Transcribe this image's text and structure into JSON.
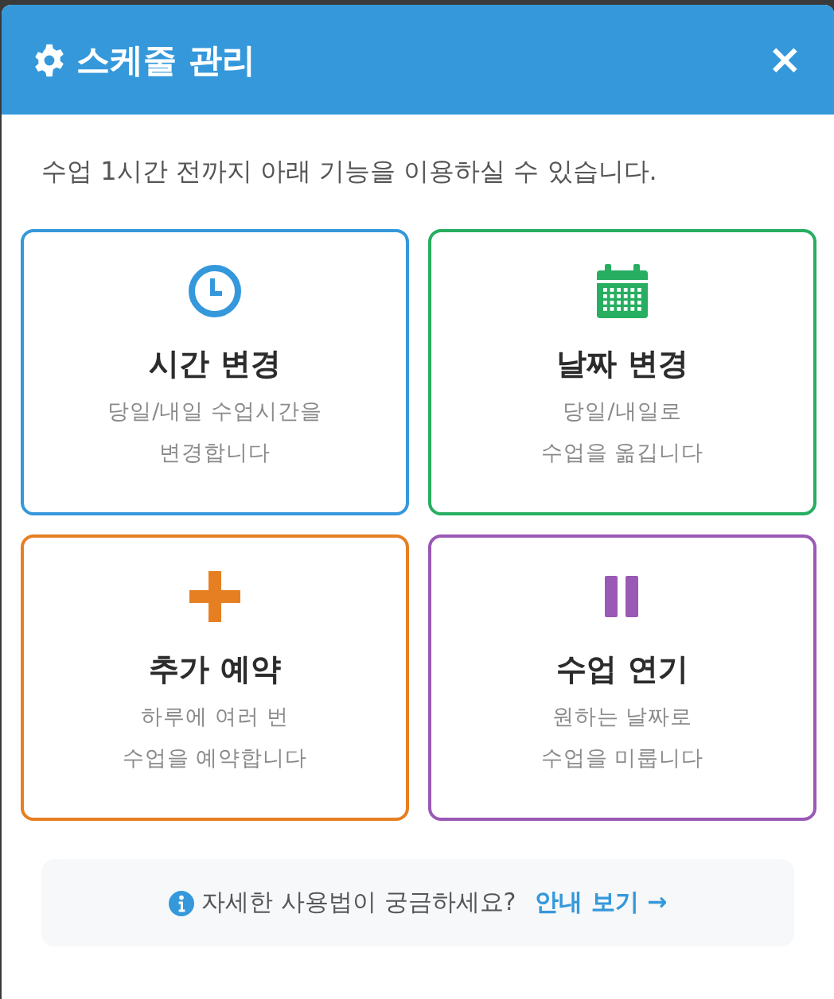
{
  "dialog": {
    "title": "스케줄 관리",
    "close": "×"
  },
  "intro": "수업 1시간 전까지 아래 기능을 이용하실 수 있습니다.",
  "options": [
    {
      "kind": "clock",
      "color": "#3498db",
      "title": "시간 변경",
      "lines": [
        "당일/내일 수업시간을",
        "변경합니다"
      ]
    },
    {
      "kind": "calendar",
      "color": "#27ae60",
      "title": "날짜 변경",
      "lines": [
        "당일/내일로",
        "수업을 옮깁니다"
      ]
    },
    {
      "kind": "plus",
      "color": "#e67e22",
      "title": "추가 예약",
      "lines": [
        "하루에 여러 번",
        "수업을 예약합니다"
      ]
    },
    {
      "kind": "pause",
      "color": "#9b59b6",
      "title": "수업 연기",
      "lines": [
        "원하는 날짜로",
        "수업을 미룹니다"
      ]
    }
  ],
  "help": {
    "text": "자세한 사용법이 궁금하세요?",
    "link": "안내 보기 →"
  }
}
